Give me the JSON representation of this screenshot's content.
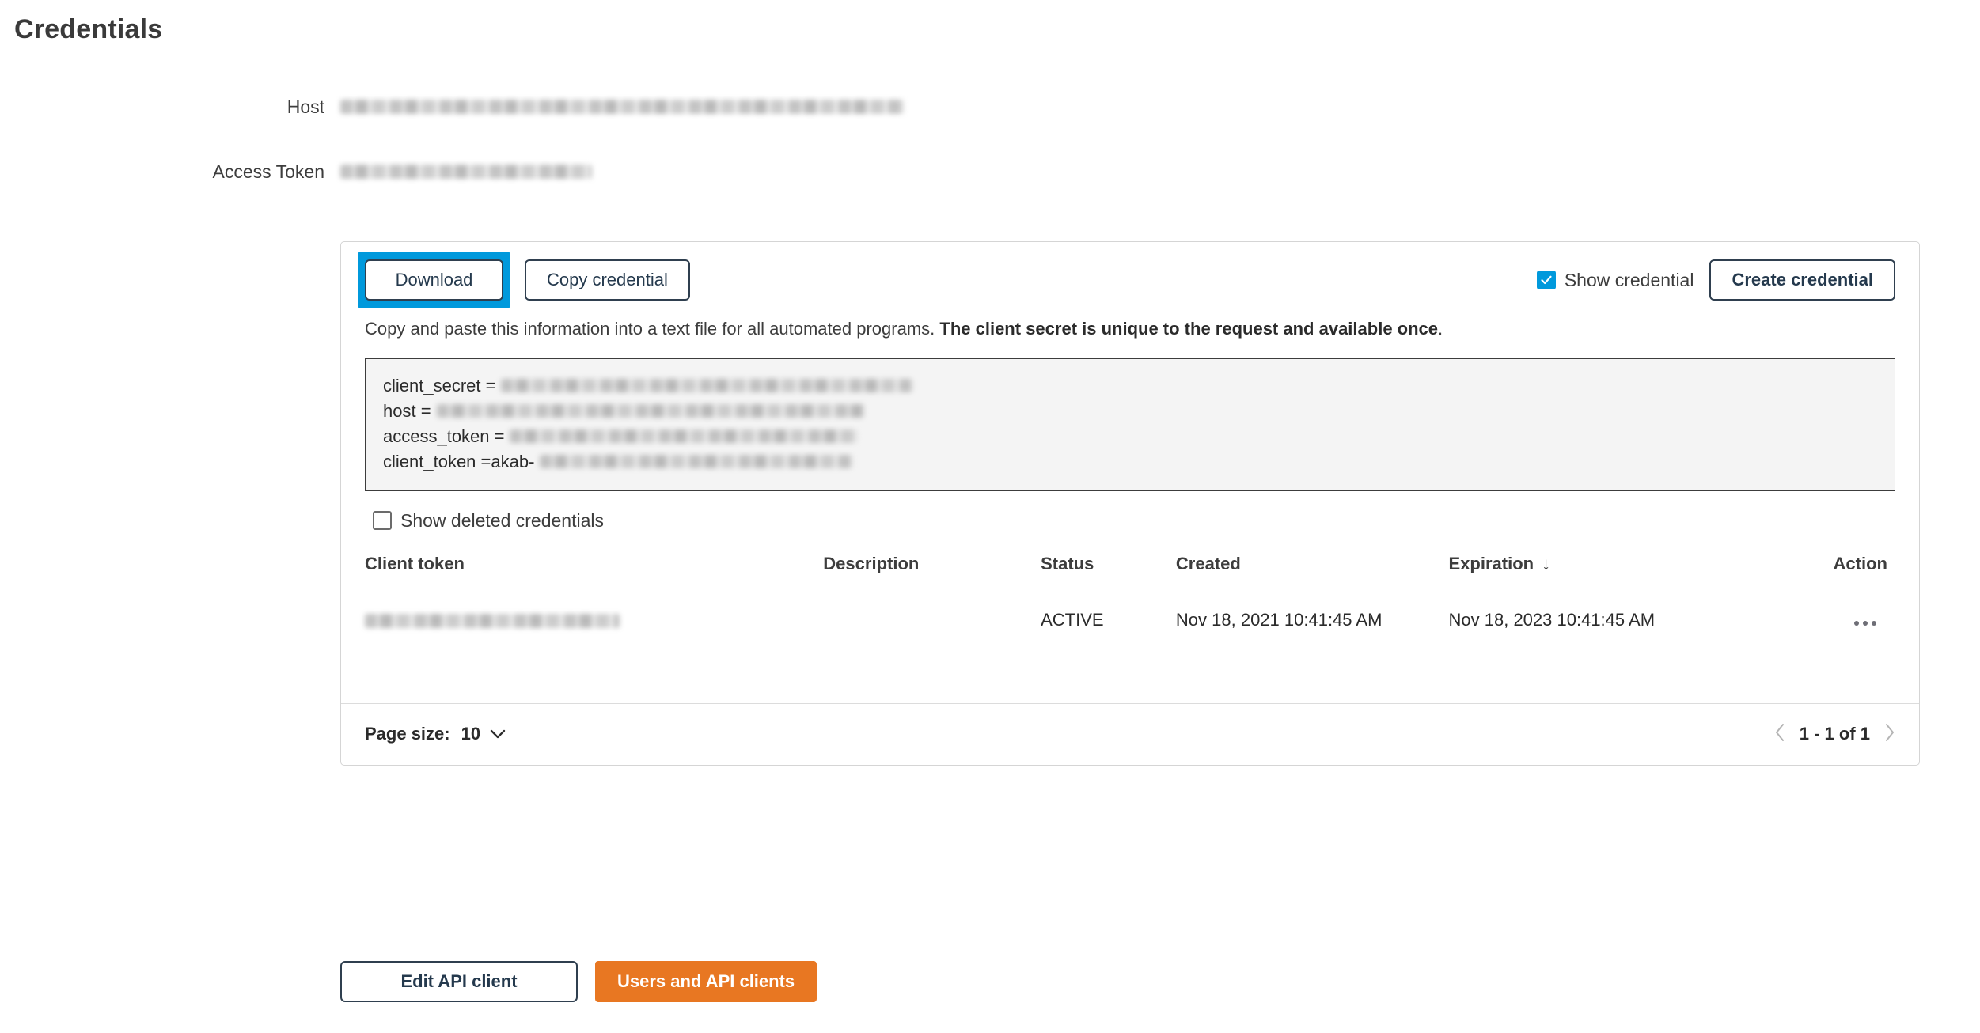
{
  "page": {
    "title": "Credentials"
  },
  "summary": {
    "host_label": "Host",
    "host_value": "",
    "access_token_label": "Access Token",
    "access_token_value": ""
  },
  "toolbar": {
    "download_label": "Download",
    "copy_credential_label": "Copy credential",
    "show_credential_label": "Show credential",
    "show_credential_checked": true,
    "create_credential_label": "Create credential",
    "highlight_color": "#0099dc"
  },
  "description": {
    "normal": "Copy and paste this information into a text file for all automated programs. ",
    "bold": "The client secret is unique to the request and available once",
    "period": "."
  },
  "credential_block": {
    "lines": [
      {
        "key": "client_secret = ",
        "value": ""
      },
      {
        "key": "host = ",
        "value": ""
      },
      {
        "key": "access_token = ",
        "value": ""
      },
      {
        "key": "client_token = ",
        "value": "akab-"
      }
    ]
  },
  "filters": {
    "show_deleted_label": "Show deleted credentials",
    "show_deleted_checked": false
  },
  "table": {
    "columns": [
      "Client token",
      "Description",
      "Status",
      "Created",
      "Expiration",
      "Action"
    ],
    "sort_column": "Expiration",
    "sort_arrow": "↓",
    "rows": [
      {
        "client_token": "",
        "description": "",
        "status": "ACTIVE",
        "created": "Nov 18, 2021 10:41:45 AM",
        "expiration": "Nov 18, 2023 10:41:45 AM",
        "action": "•••"
      }
    ]
  },
  "footer": {
    "page_size_label": "Page size:",
    "page_size_value": "10",
    "page_size_caret": "⌄",
    "prev_arrow": "‹",
    "range_text": "1 - 1 of 1",
    "next_arrow": "›"
  },
  "bottom_actions": {
    "edit_label": "Edit API client",
    "users_label": "Users and API clients",
    "primary_color": "#e87722"
  }
}
